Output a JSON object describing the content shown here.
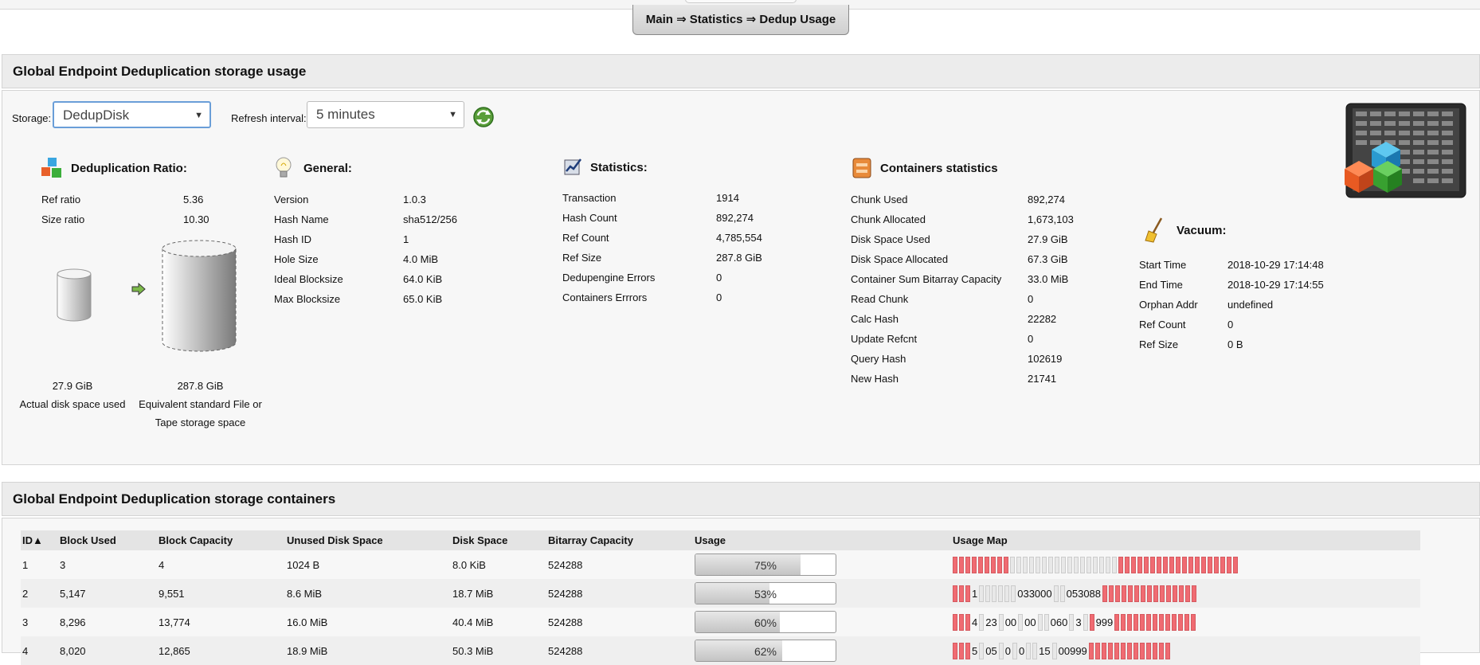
{
  "breadcrumb": "Main ⇒ Statistics ⇒ Dedup Usage",
  "panel1": {
    "title": "Global Endpoint Deduplication storage usage",
    "storage_label": "Storage:",
    "storage_value": "DedupDisk",
    "refresh_label": "Refresh interval:",
    "refresh_value": "5 minutes"
  },
  "dedup_ratio": {
    "title": "Deduplication Ratio:",
    "rows": [
      {
        "label": "Ref ratio",
        "value": "5.36"
      },
      {
        "label": "Size ratio",
        "value": "10.30"
      }
    ],
    "actual_size": "27.9 GiB",
    "actual_caption": "Actual disk space used",
    "equiv_size": "287.8 GiB",
    "equiv_caption_1": "Equivalent standard File or",
    "equiv_caption_2": "Tape storage space"
  },
  "general": {
    "title": "General:",
    "rows": [
      {
        "label": "Version",
        "value": "1.0.3"
      },
      {
        "label": "Hash Name",
        "value": "sha512/256"
      },
      {
        "label": "Hash ID",
        "value": "1"
      },
      {
        "label": "Hole Size",
        "value": "4.0 MiB"
      },
      {
        "label": "Ideal Blocksize",
        "value": "64.0 KiB"
      },
      {
        "label": "Max Blocksize",
        "value": "65.0 KiB"
      }
    ]
  },
  "statistics": {
    "title": "Statistics:",
    "rows": [
      {
        "label": "Transaction",
        "value": "1914"
      },
      {
        "label": "Hash Count",
        "value": "892,274"
      },
      {
        "label": "Ref Count",
        "value": "4,785,554"
      },
      {
        "label": "Ref Size",
        "value": "287.8 GiB"
      },
      {
        "label": "Dedupengine Errors",
        "value": "0"
      },
      {
        "label": "Containers Errrors",
        "value": "0"
      }
    ]
  },
  "containers_stats": {
    "title": "Containers statistics",
    "rows": [
      {
        "label": "Chunk Used",
        "value": "892,274"
      },
      {
        "label": "Chunk Allocated",
        "value": "1,673,103"
      },
      {
        "label": "Disk Space Used",
        "value": "27.9 GiB"
      },
      {
        "label": "Disk Space Allocated",
        "value": "67.3 GiB"
      },
      {
        "label": "Container Sum Bitarray Capacity",
        "value": "33.0 MiB"
      },
      {
        "label": "Read Chunk",
        "value": "0"
      },
      {
        "label": "Calc Hash",
        "value": "22282"
      },
      {
        "label": "Update Refcnt",
        "value": "0"
      },
      {
        "label": "Query Hash",
        "value": "102619"
      },
      {
        "label": "New Hash",
        "value": "21741"
      }
    ]
  },
  "vacuum": {
    "title": "Vacuum:",
    "rows": [
      {
        "label": "Start Time",
        "value": "2018-10-29 17:14:48"
      },
      {
        "label": "End Time",
        "value": "2018-10-29 17:14:55"
      },
      {
        "label": "Orphan Addr",
        "value": "undefined"
      },
      {
        "label": "Ref Count",
        "value": "0"
      },
      {
        "label": "Ref Size",
        "value": "0 B"
      }
    ]
  },
  "panel2": {
    "title": "Global Endpoint Deduplication storage containers",
    "columns": [
      "ID",
      "Block Used",
      "Block Capacity",
      "Unused Disk Space",
      "Disk Space",
      "Bitarray Capacity",
      "Usage",
      "Usage Map"
    ],
    "sort_indicator": "▲",
    "rows": [
      {
        "id": "1",
        "block_used": "3",
        "block_capacity": "4",
        "unused": "1024 B",
        "disk_space": "8.0 KiB",
        "bitarray": "524288",
        "usage_pct": 75,
        "usage_label": "75%",
        "map": "UUUUUUUUUFFFFFFFFFFFFFFFFFUUUUUUUUUUUUUUUUUUU"
      },
      {
        "id": "2",
        "block_used": "5,147",
        "block_capacity": "9,551",
        "unused": "8.6 MiB",
        "disk_space": "18.7 MiB",
        "bitarray": "524288",
        "usage_pct": 53,
        "usage_label": "53%",
        "map": "UUU|1|FFFFFF|033000|FF|053088|UUUUUUUUUUUUUUU"
      },
      {
        "id": "3",
        "block_used": "8,296",
        "block_capacity": "13,774",
        "unused": "16.0 MiB",
        "disk_space": "40.4 MiB",
        "bitarray": "524288",
        "usage_pct": 60,
        "usage_label": "60%",
        "map": "UUU|4|F|23|F|00|F|00|FF|060|F|3|FU|999|UUUUUUUUUUUUU"
      },
      {
        "id": "4",
        "block_used": "8,020",
        "block_capacity": "12,865",
        "unused": "18.9 MiB",
        "disk_space": "50.3 MiB",
        "bitarray": "524288",
        "usage_pct": 62,
        "usage_label": "62%",
        "map": "UUU|5|F|05|F|0|F|0|FF|15|F|00999|UUUUUUUUUUUUU"
      }
    ]
  },
  "colors": {
    "map_used": "#f06b72",
    "map_free": "#e8e8e8",
    "panel_header": "#ececec"
  }
}
